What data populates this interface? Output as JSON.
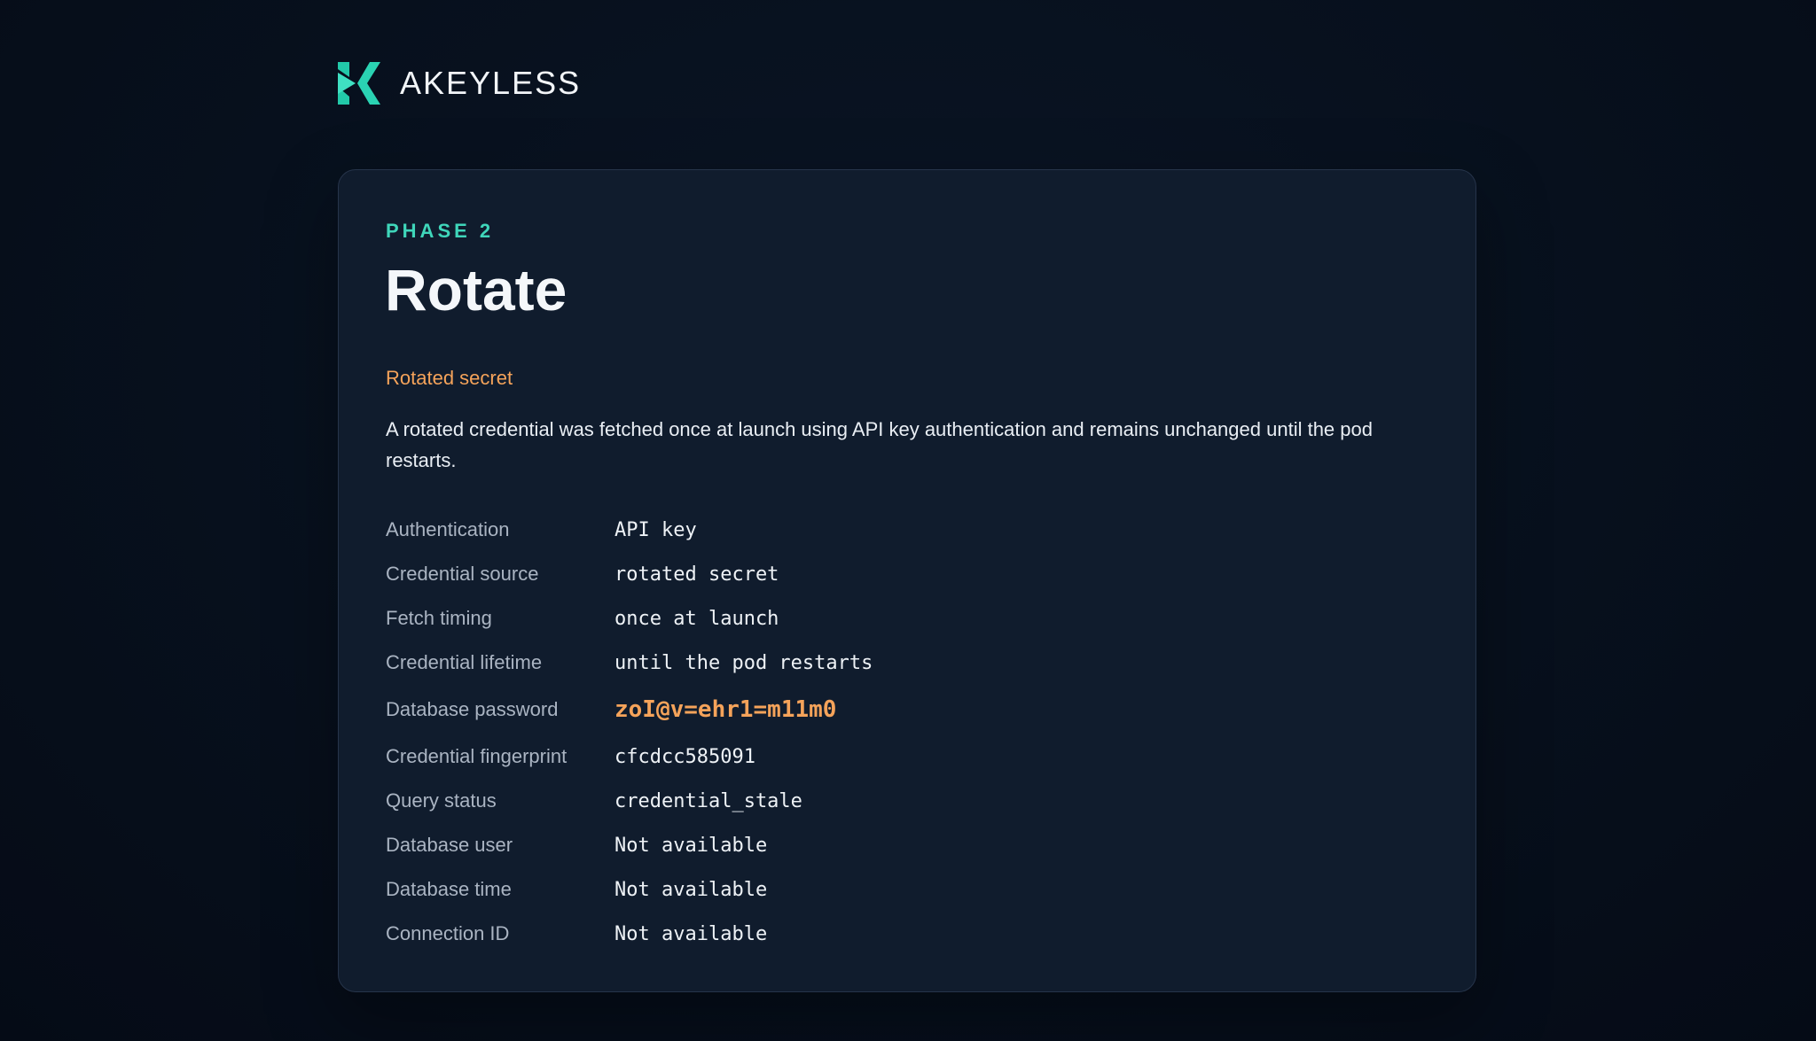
{
  "brand": {
    "name": "AKEYLESS",
    "accent_color": "#3fd6ba",
    "icon": "akeyless-logo-icon"
  },
  "card": {
    "phase": "PHASE 2",
    "title": "Rotate",
    "subtitle": "Rotated secret",
    "description": "A rotated credential was fetched once at launch using API key authentication and remains unchanged until the pod restarts.",
    "highlight_color": "#f5a35a",
    "rows": [
      {
        "label": "Authentication",
        "value": "API key"
      },
      {
        "label": "Credential source",
        "value": "rotated secret"
      },
      {
        "label": "Fetch timing",
        "value": "once at launch"
      },
      {
        "label": "Credential lifetime",
        "value": "until the pod restarts"
      },
      {
        "label": "Database password",
        "value": "zoI@v=ehr1=m11m0"
      },
      {
        "label": "Credential fingerprint",
        "value": "cfcdcc585091"
      },
      {
        "label": "Query status",
        "value": "credential_stale"
      },
      {
        "label": "Database user",
        "value": "Not available"
      },
      {
        "label": "Database time",
        "value": "Not available"
      },
      {
        "label": "Connection ID",
        "value": "Not available"
      }
    ]
  }
}
